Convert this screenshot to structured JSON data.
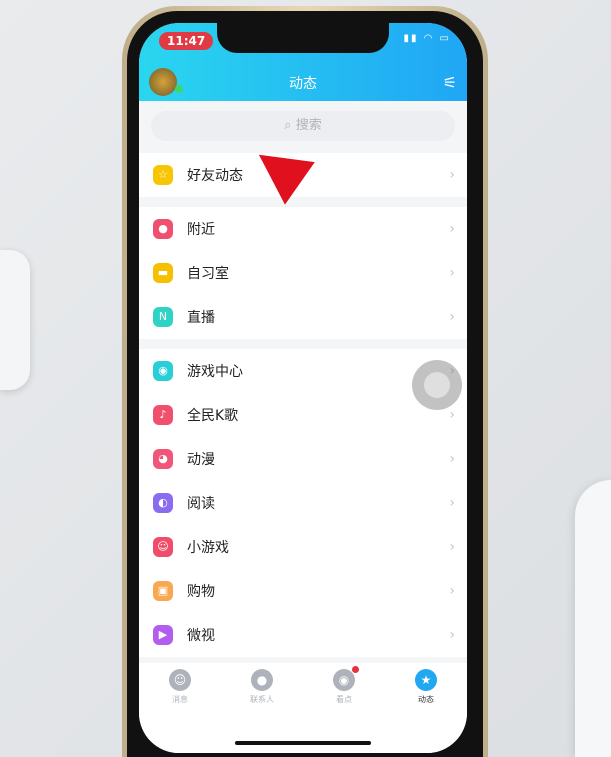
{
  "status": {
    "time": "11:47",
    "icons": "signal wifi battery"
  },
  "header": {
    "title": "动态",
    "filter_icon": "sliders-icon"
  },
  "search": {
    "placeholder": "搜索",
    "icon": "⌕"
  },
  "groups": [
    [
      {
        "label": "好友动态",
        "color": "#f7c600",
        "glyph": "☆"
      }
    ],
    [
      {
        "label": "附近",
        "color": "#f0506e",
        "glyph": "●"
      },
      {
        "label": "自习室",
        "color": "#f5c000",
        "glyph": "▬"
      },
      {
        "label": "直播",
        "color": "#2ed3c6",
        "glyph": "N"
      }
    ],
    [
      {
        "label": "游戏中心",
        "color": "#28cfd8",
        "glyph": "◉"
      },
      {
        "label": "全民K歌",
        "color": "#f0506e",
        "glyph": "♪"
      },
      {
        "label": "动漫",
        "color": "#f2557a",
        "glyph": "◕"
      },
      {
        "label": "阅读",
        "color": "#8a6cf0",
        "glyph": "◐"
      },
      {
        "label": "小游戏",
        "color": "#f04d6a",
        "glyph": "☺"
      },
      {
        "label": "购物",
        "color": "#f7a850",
        "glyph": "▣"
      },
      {
        "label": "微视",
        "color": "#b25cf0",
        "glyph": "▶"
      }
    ]
  ],
  "tabs": [
    {
      "label": "消息",
      "glyph": "☺"
    },
    {
      "label": "联系人",
      "glyph": "●"
    },
    {
      "label": "看点",
      "glyph": "◉",
      "badge": true
    },
    {
      "label": "动态",
      "glyph": "★",
      "active": true
    }
  ],
  "chevron": "›"
}
